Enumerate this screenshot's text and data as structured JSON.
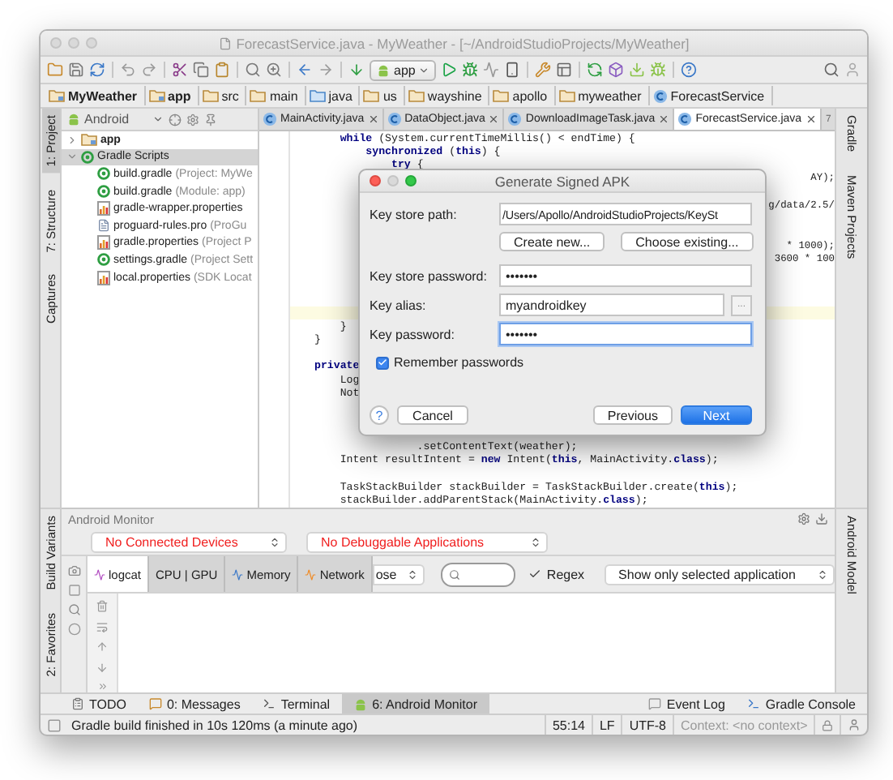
{
  "window": {
    "title": "ForecastService.java - MyWeather - [~/AndroidStudioProjects/MyWeather]"
  },
  "toolbar": {
    "run_config": "app"
  },
  "breadcrumbs": [
    {
      "label": "MyWeather",
      "kind": "module"
    },
    {
      "label": "app",
      "kind": "module"
    },
    {
      "label": "src",
      "kind": "folder"
    },
    {
      "label": "main",
      "kind": "folder"
    },
    {
      "label": "java",
      "kind": "source"
    },
    {
      "label": "us",
      "kind": "folder"
    },
    {
      "label": "wayshine",
      "kind": "folder"
    },
    {
      "label": "apollo",
      "kind": "folder"
    },
    {
      "label": "myweather",
      "kind": "folder"
    },
    {
      "label": "ForecastService",
      "kind": "class"
    }
  ],
  "left_stripe_top": [
    {
      "label": "1: Project",
      "selected": true
    },
    {
      "label": "7: Structure",
      "selected": false
    },
    {
      "label": "Captures",
      "selected": false
    }
  ],
  "left_stripe_bottom": [
    {
      "label": "Build Variants",
      "selected": false
    },
    {
      "label": "2: Favorites",
      "selected": false
    }
  ],
  "right_stripe_top": [
    "Gradle",
    "Maven Projects"
  ],
  "right_stripe_bottom": [
    "Android Model"
  ],
  "project_panel": {
    "view": "Android",
    "tree": [
      {
        "label": "app",
        "expanded": false,
        "selected": false
      },
      {
        "label": "Gradle Scripts",
        "expanded": true,
        "selected": true,
        "children": [
          {
            "name": "build.gradle",
            "detail": "(Project: MyWe",
            "kind": "gradle"
          },
          {
            "name": "build.gradle",
            "detail": "(Module: app)",
            "kind": "gradle"
          },
          {
            "name": "gradle-wrapper.properties",
            "kind": "properties"
          },
          {
            "name": "proguard-rules.pro",
            "detail": "(ProGu",
            "kind": "file"
          },
          {
            "name": "gradle.properties",
            "detail": "(Project P",
            "kind": "properties"
          },
          {
            "name": "settings.gradle",
            "detail": "(Project Sett",
            "kind": "gradle"
          },
          {
            "name": "local.properties",
            "detail": "(SDK Locat",
            "kind": "properties"
          }
        ]
      }
    ]
  },
  "editor": {
    "tabs": [
      {
        "label": "MainActivity.java",
        "selected": false
      },
      {
        "label": "DataObject.java",
        "selected": false
      },
      {
        "label": "DownloadImageTask.java",
        "selected": false
      },
      {
        "label": "ForecastService.java",
        "selected": true
      }
    ],
    "overflow": "7",
    "lines": [
      {
        "code": "    **while** (System.currentTimeMillis() < endTime) {",
        "current": false
      },
      {
        "code": "        **synchronized** (**this**) {",
        "current": false
      },
      {
        "code": "            **try** {",
        "current": false
      },
      {
        "tail": "AY);",
        "current": false
      },
      {
        "current": false
      },
      {
        "tail": "g/data/2.5/",
        "current": false
      },
      {
        "current": false
      },
      {
        "current": false
      },
      {
        "tail": "* 1000);",
        "current": false
      },
      {
        "tail": "3600 * 100",
        "current": false
      },
      {
        "current": false
      },
      {
        "current": false
      },
      {
        "current": false
      },
      {
        "current": true
      },
      {
        "code": "    }",
        "current": false
      },
      {
        "code": "}",
        "current": false
      },
      {
        "current": false
      },
      {
        "code": "**private**",
        "current": false
      },
      {
        "code": "    Log",
        "current": false
      },
      {
        "code": "    Not",
        "current": false
      },
      {
        "current": false
      },
      {
        "current": false
      },
      {
        "current": false
      },
      {
        "code": "                .setContentText(weather);",
        "current": false
      },
      {
        "code": "    Intent resultIntent = **new** Intent(**this**, MainActivity.**class**);",
        "current": false
      },
      {
        "current": false
      },
      {
        "code": "    TaskStackBuilder stackBuilder = TaskStackBuilder.create(**this**);",
        "current": false
      },
      {
        "code": "    stackBuilder.addParentStack(MainActivity.**class**);",
        "current": false
      }
    ]
  },
  "dialog": {
    "title": "Generate Signed APK",
    "path_field": {
      "label": "Key store path:",
      "value": "/Users/Apollo/AndroidStudioProjects/KeySt"
    },
    "store_buttons": [
      "Create new...",
      "Choose existing..."
    ],
    "fields": [
      {
        "label": "Key store password:",
        "value": "•••••••",
        "focused": false
      },
      {
        "label": "Key alias:",
        "value": "myandroidkey",
        "focused": false,
        "browse": "..."
      },
      {
        "label": "Key password:",
        "value": "•••••••",
        "focused": true
      }
    ],
    "remember": {
      "label": "Remember passwords",
      "checked": true
    },
    "help": "?",
    "buttons": [
      {
        "label": "Cancel",
        "kind": "plain"
      },
      {
        "label": "Previous",
        "kind": "plain"
      },
      {
        "label": "Next",
        "kind": "default"
      }
    ]
  },
  "android_monitor": {
    "title": "Android Monitor",
    "device_select": "No Connected Devices",
    "app_select": "No Debuggable Applications",
    "tabs": [
      {
        "label": "logcat",
        "selected": true
      },
      {
        "label": "CPU | GPU",
        "selected": false
      },
      {
        "label": "Memory",
        "selected": false
      },
      {
        "label": "Network",
        "selected": false
      }
    ],
    "level_select": "ose",
    "regex": {
      "label": "Regex",
      "checked": true
    },
    "filter_select": "Show only selected application"
  },
  "tool_windows": [
    {
      "label": "TODO",
      "selected": false
    },
    {
      "label": "0: Messages",
      "selected": false
    },
    {
      "label": "Terminal",
      "selected": false
    },
    {
      "label": "6: Android Monitor",
      "selected": true
    }
  ],
  "tool_windows_right": [
    "Event Log",
    "Gradle Console"
  ],
  "status_bar": {
    "message": "Gradle build finished in 10s 120ms (a minute ago)",
    "position": "55:14",
    "line_separator": "LF",
    "encoding": "UTF-8",
    "context": "Context: <no context>"
  }
}
